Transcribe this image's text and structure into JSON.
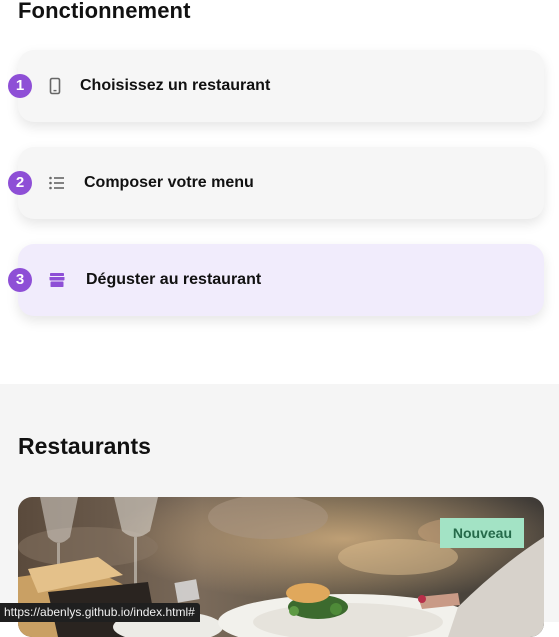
{
  "how_section": {
    "title": "Fonctionnement",
    "steps": [
      {
        "number": "1",
        "icon": "smartphone-icon",
        "label": "Choisissez un restaurant",
        "active": false
      },
      {
        "number": "2",
        "icon": "list-icon",
        "label": "Composer votre menu",
        "active": false
      },
      {
        "number": "3",
        "icon": "store-icon",
        "label": "Déguster au restaurant",
        "active": true
      }
    ]
  },
  "restaurants_section": {
    "title": "Restaurants",
    "card": {
      "badge": "Nouveau",
      "image": "restaurant-dish-photo"
    }
  },
  "status_bar": {
    "url": "https://abenlys.github.io/index.html#"
  },
  "colors": {
    "accent": "#8e4fd6",
    "badge_bg": "#a3e3c5",
    "badge_text": "#256a4a",
    "active_step_bg": "#f1ecfc",
    "section_bg": "#f5f5f5"
  }
}
